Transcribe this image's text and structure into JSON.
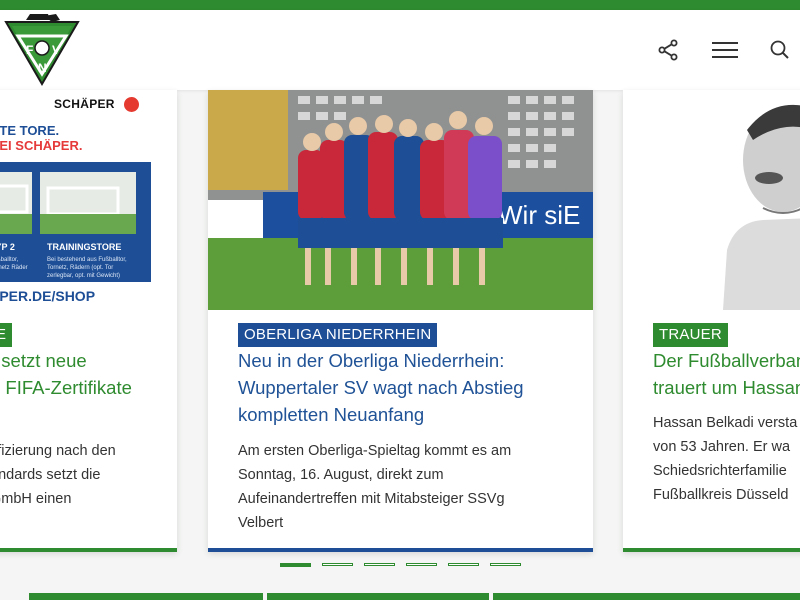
{
  "header": {
    "logo_letters": [
      "F",
      "V",
      "N"
    ],
    "share_icon": "share-icon",
    "menu_icon": "hamburger-menu-icon",
    "search_icon": "search-icon"
  },
  "colors": {
    "brand_green": "#2f8b2f",
    "headline_green": "#2f8b2f",
    "headline_blue": "#1f5296",
    "badge_blue": "#1d4e96"
  },
  "slides": [
    {
      "ad": {
        "brand": "SCHÄPER",
        "slogan_1": "RTE TORE.",
        "slogan_2": "BEI SCHÄPER.",
        "product_1_title": "TYP 2",
        "product_1_text": "Fußballtor, Tornetz Räder",
        "product_2_title": "TRAININGSTORE",
        "product_2_text": "Bei bestehend aus Fußballtor, Tornetz, Rädern (opt. Tor zerlegbar, opt. mit Gewicht)",
        "url": "EPER.DE/SHOP"
      },
      "badge": "E",
      "headline": [
        "r setzt neue",
        "e FIFA-Zertifikate"
      ],
      "teaser": [
        "tifizierung nach den",
        "andards setzt die",
        "GmbH einen"
      ]
    },
    {
      "badge": "OBERLIGA NIEDERRHEIN",
      "headline": [
        "Neu in der Oberliga Niederrhein:",
        "Wuppertaler SV wagt nach Abstieg",
        "kompletten Neuanfang"
      ],
      "teaser": [
        "Am ersten Oberliga-Spieltag kommt es am",
        "Sonntag, 16. August, direkt zum",
        "Aufeinandertreffen mit Mitabsteiger SSVg",
        "Velbert"
      ],
      "photo_banner": "Wir siE"
    },
    {
      "badge": "TRAUER",
      "headline": [
        "Der Fußballverban",
        "trauert um Hassan"
      ],
      "teaser": [
        "Hassan Belkadi versta",
        "von 53 Jahren. Er wa",
        "Schiedsrichterfamilie",
        "Fußballkreis Düsseld"
      ]
    }
  ],
  "pagination": {
    "count": 6,
    "active": 1
  }
}
